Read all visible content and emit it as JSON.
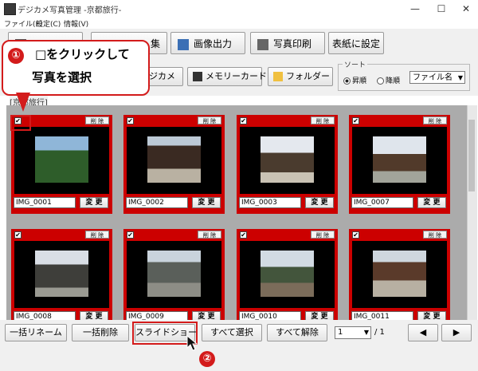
{
  "window": {
    "title": "デジカメ写真管理 -京都旅行-",
    "controls": [
      "—",
      "☐",
      "✕"
    ]
  },
  "menu": [
    "ファイル(F)",
    "設定(C)",
    "情報(V)"
  ],
  "toolbar": {
    "btn_partial": "集",
    "image_output": "画像出力",
    "photo_print": "写真印刷",
    "cover_setting": "表紙に設定"
  },
  "sources": {
    "camera": "ジカメ",
    "memory_card": "メモリーカード",
    "folder": "フォルダー"
  },
  "sort": {
    "legend": "ソート",
    "ascending": "昇順",
    "descending": "降順",
    "field": "ファイル名"
  },
  "group_label": "[京都旅行]",
  "photos": [
    {
      "name": "IMG_0001",
      "checked": true
    },
    {
      "name": "IMG_0002",
      "checked": true
    },
    {
      "name": "IMG_0003",
      "checked": true
    },
    {
      "name": "IMG_0007",
      "checked": true
    },
    {
      "name": "IMG_0008",
      "checked": true
    },
    {
      "name": "IMG_0009",
      "checked": true
    },
    {
      "name": "IMG_0010",
      "checked": true
    },
    {
      "name": "IMG_0011",
      "checked": true
    }
  ],
  "card_labels": {
    "delete": "削 除",
    "edit": "変 更",
    "check": "✔"
  },
  "bottom": {
    "bulk_rename": "一括リネーム",
    "bulk_delete": "一括削除",
    "slideshow": "スライドショー",
    "select_all": "すべて選択",
    "deselect_all": "すべて解除",
    "page": "1",
    "total": "/ 1",
    "prev": "◀",
    "next": "▶"
  },
  "callout": {
    "step1": "①",
    "line1": "□をクリックして",
    "line2": "写真を選択",
    "step2": "②"
  },
  "colors": {
    "card_red": "#cc0000",
    "callout_red": "#d31b1b"
  }
}
